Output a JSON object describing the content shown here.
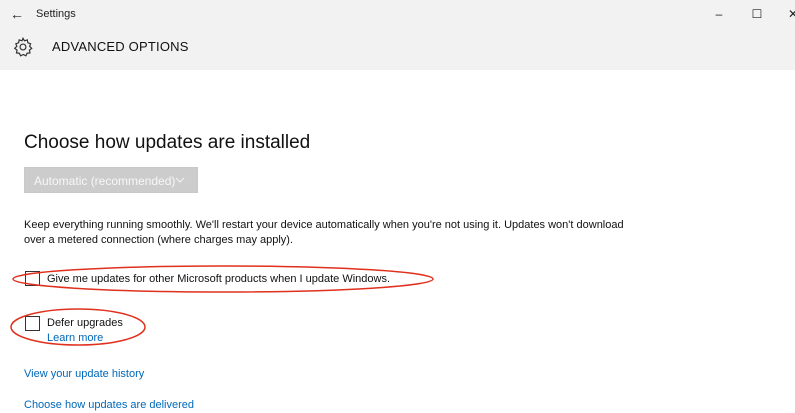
{
  "window": {
    "app_title": "Settings",
    "back_glyph": "←",
    "minimize_glyph": "–",
    "maximize_glyph": "☐",
    "close_glyph": "✕"
  },
  "header": {
    "icon": "gear-icon",
    "title": "ADVANCED OPTIONS"
  },
  "main": {
    "section_title": "Choose how updates are installed",
    "install_mode": {
      "selected": "Automatic (recommended)",
      "enabled": false
    },
    "description": "Keep everything running smoothly. We'll restart your device automatically when you're not using it. Updates won't download over a metered connection (where charges may apply).",
    "options": [
      {
        "label": "Give me updates for other Microsoft products when I update Windows.",
        "checked": false
      },
      {
        "label": "Defer upgrades",
        "checked": false,
        "link": "Learn more"
      }
    ],
    "links": {
      "history": "View your update history",
      "delivery": "Choose how updates are delivered"
    }
  },
  "colors": {
    "titlebar_bg": "#f2f2f2",
    "link": "#0067b8",
    "annotation": "#e0301e",
    "dropdown_disabled_bg": "#cccccc"
  }
}
